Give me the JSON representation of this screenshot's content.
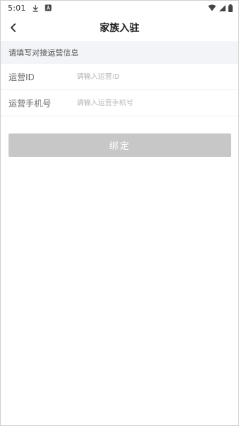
{
  "status_bar": {
    "time": "5:01",
    "icons": [
      "download-icon",
      "notification-a-icon",
      "wifi-icon",
      "signal-icon",
      "battery-icon"
    ]
  },
  "nav": {
    "title": "家族入驻",
    "back_icon": "chevron-left-icon"
  },
  "section": {
    "header": "请填写对接运营信息"
  },
  "form": {
    "fields": [
      {
        "label": "运营ID",
        "placeholder": "请输入运营ID",
        "value": ""
      },
      {
        "label": "运营手机号",
        "placeholder": "请输入运营手机号",
        "value": ""
      }
    ]
  },
  "actions": {
    "bind_label": "绑定",
    "bind_color": "#c7c7c7"
  }
}
